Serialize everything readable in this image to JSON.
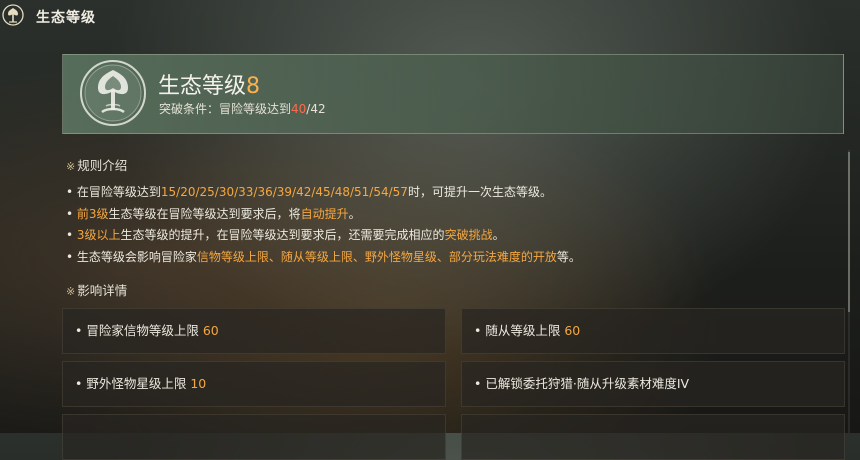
{
  "header": {
    "title": "生态等级"
  },
  "eco": {
    "title_prefix": "生态等级",
    "level": "8",
    "condition_label": "突破条件：冒险等级达到",
    "condition_current": "40",
    "condition_total": "/42"
  },
  "rules": {
    "heading": "规则介绍",
    "items": [
      [
        {
          "t": "• 在冒险等级达到",
          "c": ""
        },
        {
          "t": "15/20/25/30/33/36/39/42/45/48/51/54/57",
          "c": "org"
        },
        {
          "t": "时，可提升一次生态等级。",
          "c": ""
        }
      ],
      [
        {
          "t": "• ",
          "c": ""
        },
        {
          "t": "前3级",
          "c": "org"
        },
        {
          "t": "生态等级在冒险等级达到要求后，将",
          "c": ""
        },
        {
          "t": "自动提升",
          "c": "org"
        },
        {
          "t": "。",
          "c": ""
        }
      ],
      [
        {
          "t": "• ",
          "c": ""
        },
        {
          "t": "3级以上",
          "c": "org"
        },
        {
          "t": "生态等级的提升，在冒险等级达到要求后，还需要完成相应的",
          "c": ""
        },
        {
          "t": "突破挑战",
          "c": "org"
        },
        {
          "t": "。",
          "c": ""
        }
      ],
      [
        {
          "t": "• 生态等级会影响冒险家",
          "c": ""
        },
        {
          "t": "信物等级上限、随从等级上限、野外怪物星级、部分玩法难度的开放",
          "c": "org"
        },
        {
          "t": "等。",
          "c": ""
        }
      ]
    ]
  },
  "effects": {
    "heading": "影响详情",
    "items": [
      {
        "label": "• 冒险家信物等级上限",
        "value": "60"
      },
      {
        "label": "• 随从等级上限",
        "value": "60"
      },
      {
        "label": "• 野外怪物星级上限",
        "value": "10"
      },
      {
        "label": "• 已解锁委托狩猎·随从升级素材难度IV",
        "value": ""
      }
    ]
  },
  "icons": {
    "top": "tree-emblem-icon",
    "emblem": "tree-emblem-icon"
  },
  "colors": {
    "accent_orange": "#f5a742",
    "level_orange": "#ffb04a",
    "progress_red": "#ff6a4d"
  }
}
